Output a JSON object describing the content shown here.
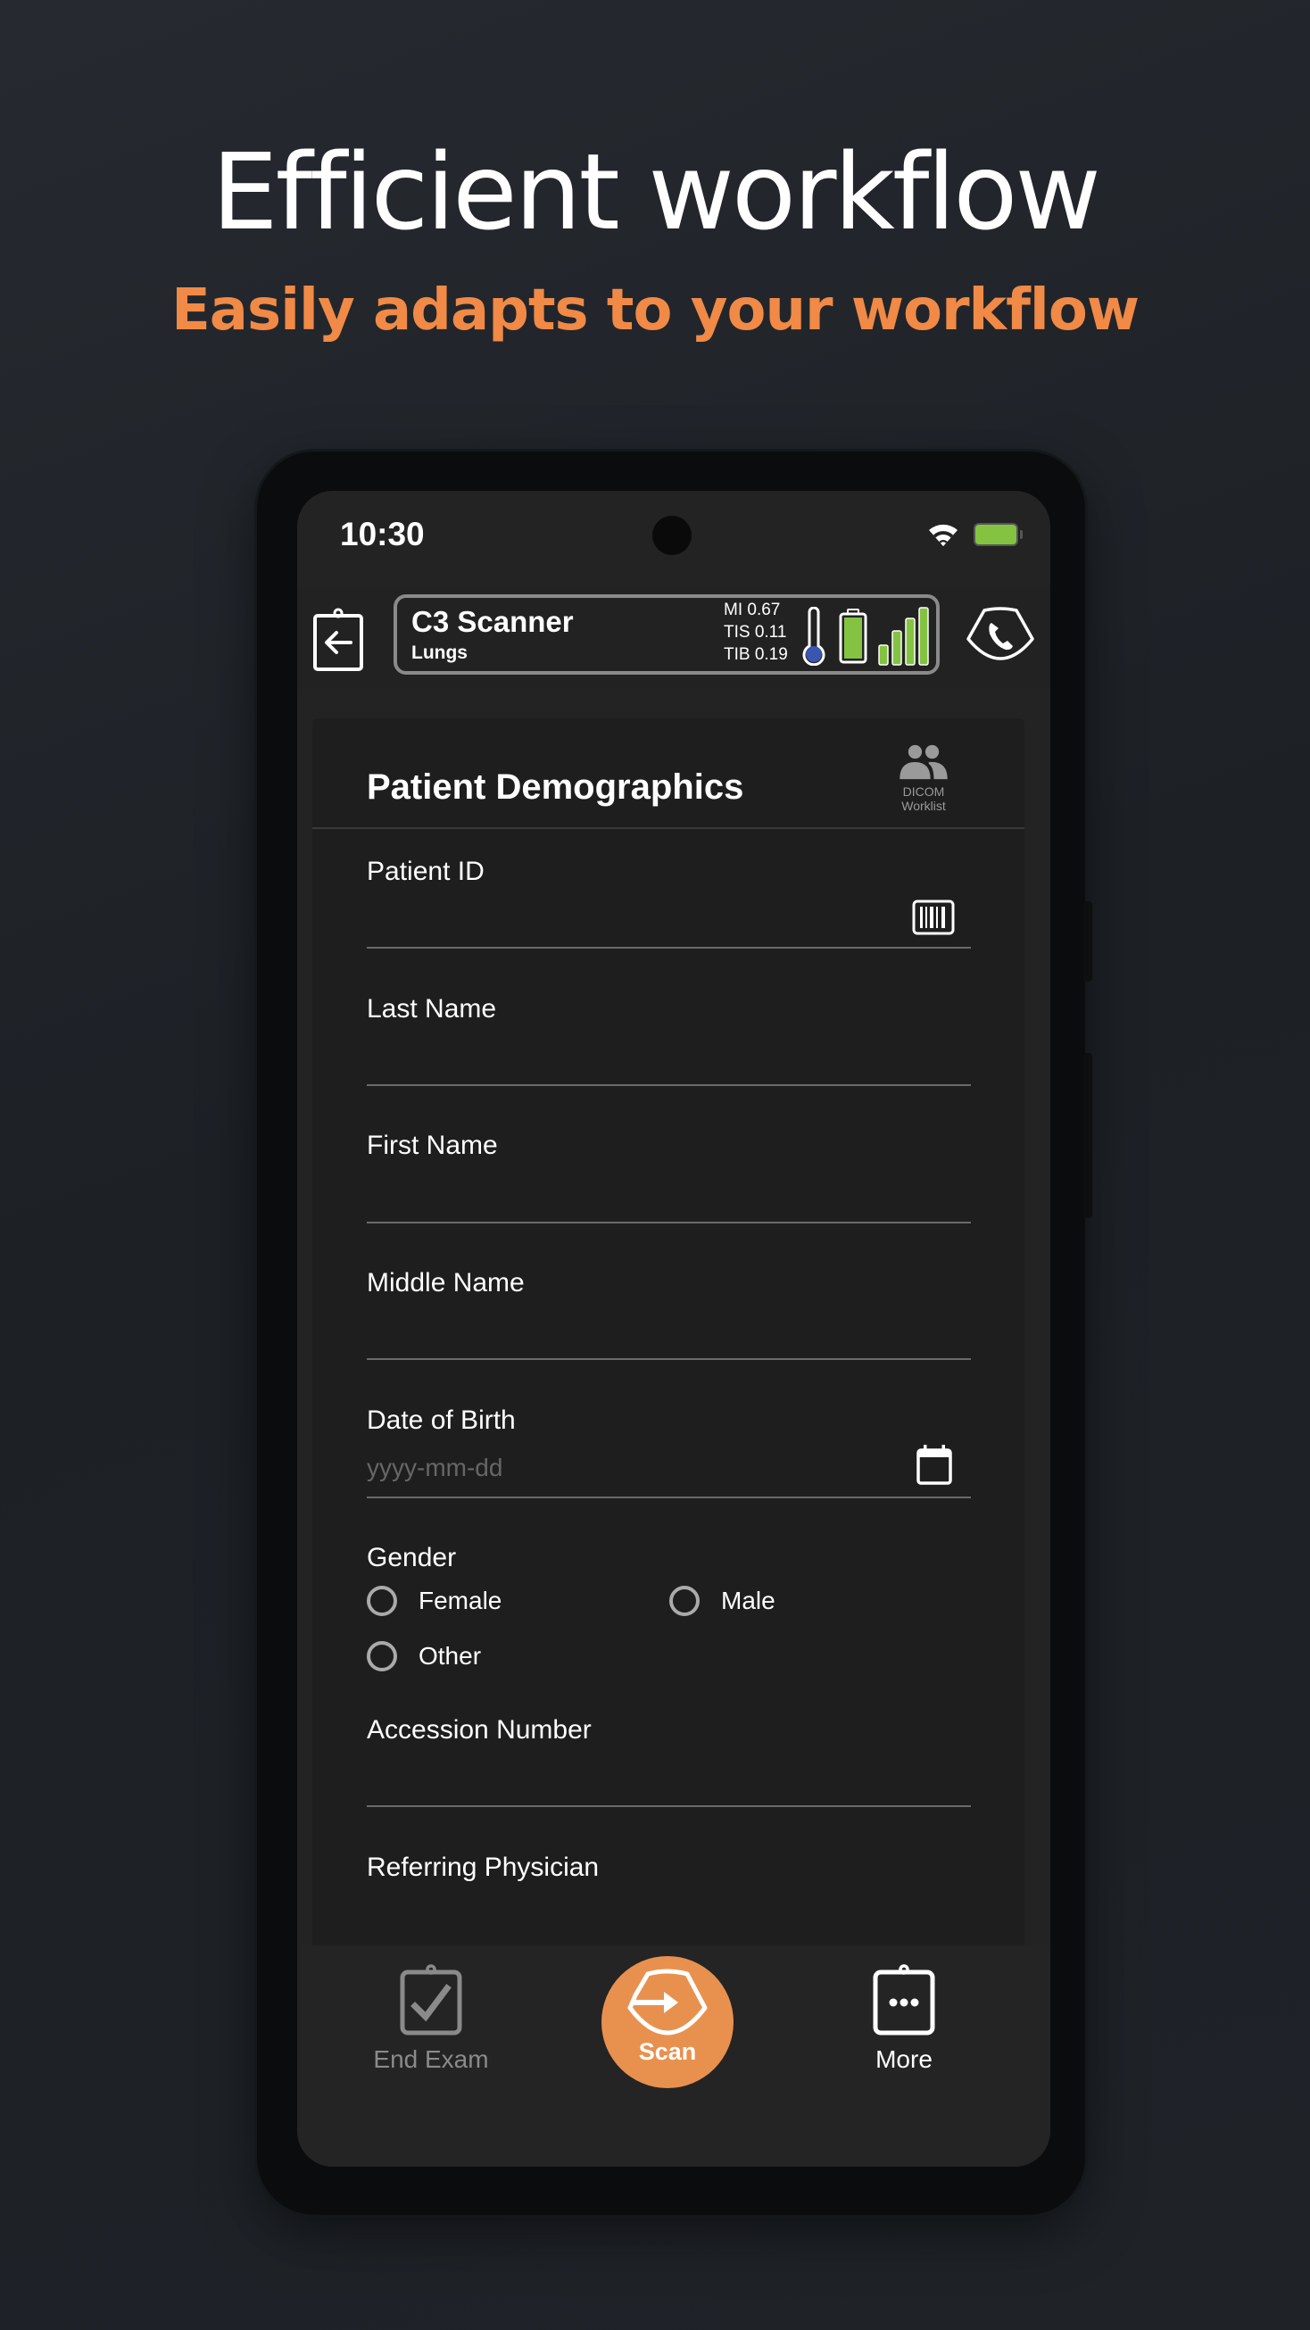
{
  "promo": {
    "headline": "Efficient workflow",
    "subheadline": "Easily adapts to your workflow",
    "accent_color": "#F08A46"
  },
  "status_bar": {
    "time": "10:30",
    "wifi_icon": "wifi-icon",
    "battery_icon": "battery-full-icon",
    "battery_color": "#84C341"
  },
  "header": {
    "back_icon": "clipboard-back-icon",
    "scanner_name": "C3 Scanner",
    "preset": "Lungs",
    "metrics": [
      {
        "label": "MI",
        "value": "0.67",
        "text": "MI 0.67"
      },
      {
        "label": "TIS",
        "value": "0.11",
        "text": "TIS 0.11"
      },
      {
        "label": "TIB",
        "value": "0.19",
        "text": "TIB 0.19"
      }
    ],
    "temperature_level": 0.25,
    "probe_battery_level": 1.0,
    "signal_bars": 4,
    "signal_bars_total": 4,
    "call_icon": "ultrasound-call-icon"
  },
  "form": {
    "title": "Patient Demographics",
    "dicom_button": {
      "line1": "DICOM",
      "line2": "Worklist"
    },
    "fields": [
      {
        "label": "Patient ID",
        "value": "",
        "placeholder": "",
        "icon": "barcode-icon"
      },
      {
        "label": "Last Name",
        "value": "",
        "placeholder": ""
      },
      {
        "label": "First Name",
        "value": "",
        "placeholder": ""
      },
      {
        "label": "Middle Name",
        "value": "",
        "placeholder": ""
      },
      {
        "label": "Date of Birth",
        "value": "",
        "placeholder": "yyyy-mm-dd",
        "icon": "calendar-icon"
      }
    ],
    "gender": {
      "label": "Gender",
      "options": [
        "Female",
        "Male",
        "Other"
      ],
      "selected": null
    },
    "accession": {
      "label": "Accession Number",
      "value": "",
      "placeholder": ""
    },
    "referring": {
      "label": "Referring Physician",
      "value": "",
      "placeholder": ""
    }
  },
  "bottom_nav": {
    "end_exam": "End Exam",
    "scan": "Scan",
    "more": "More",
    "scan_color": "#E8914E"
  }
}
